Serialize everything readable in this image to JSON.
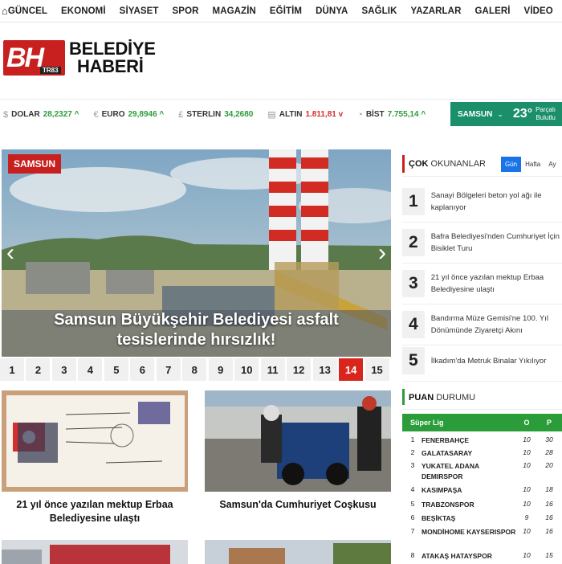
{
  "nav": {
    "home_icon": "home-icon",
    "items": [
      "GÜNCEL",
      "EKONOMİ",
      "SİYASET",
      "SPOR",
      "MAGAZİN",
      "EĞİTİM",
      "DÜNYA",
      "SAĞLIK",
      "YAZARLAR",
      "GALERİ",
      "VİDEO"
    ],
    "menu_icon": "≡ ▾"
  },
  "logo": {
    "mark": "BH",
    "badge": "TR83",
    "line1": "BELEDİYE",
    "line2": "HABERİ"
  },
  "ticker": [
    {
      "name": "DOLAR",
      "value": "28,2327",
      "trend": "up",
      "icon": "$"
    },
    {
      "name": "EURO",
      "value": "29,8946",
      "trend": "up",
      "icon": "€"
    },
    {
      "name": "STERLIN",
      "value": "34,2680",
      "trend": "none",
      "icon": "£"
    },
    {
      "name": "ALTIN",
      "value": "1.811,81",
      "trend": "down",
      "icon": "▤"
    },
    {
      "name": "BİST",
      "value": "7.755,14",
      "trend": "up",
      "icon": "◔"
    }
  ],
  "weather": {
    "city": "SAMSUN",
    "temp": "23°",
    "cond1": "Parçalı",
    "cond2": "Bulutlu"
  },
  "slider": {
    "category": "SAMSUN",
    "headline_line1": "Samsun Büyükşehir Belediyesi asfalt",
    "headline_line2": "tesislerinde hırsızlık!",
    "prev": "‹",
    "next": "›"
  },
  "pager": {
    "pages": [
      "1",
      "2",
      "3",
      "4",
      "5",
      "6",
      "7",
      "8",
      "9",
      "10",
      "11",
      "12",
      "13",
      "14",
      "15"
    ],
    "active": "14"
  },
  "cards": [
    {
      "title_line1": "21 yıl önce yazılan mektup Erbaa",
      "title_line2": "Belediyesine ulaştı"
    },
    {
      "title_line1": "Samsun'da Cumhuriyet Coşkusu",
      "title_line2": ""
    }
  ],
  "popular": {
    "title_bold": "ÇOK",
    "title_rest": " OKUNANLAR",
    "tabs": [
      "Gün",
      "Hafta",
      "Ay"
    ],
    "items": [
      {
        "num": "1",
        "text": "Sanayi Bölgeleri beton yol ağı ile kaplanıyor"
      },
      {
        "num": "2",
        "text": "Bafra Belediyesi'nden Cumhuriyet İçin Bisiklet Turu"
      },
      {
        "num": "3",
        "text": "21 yıl önce yazılan mektup Erbaa Belediyesine ulaştı"
      },
      {
        "num": "4",
        "text": "Bandırma Müze Gemisi'ne 100. Yıl Dönümünde Ziyaretçi Akını"
      },
      {
        "num": "5",
        "text": "İlkadım'da Metruk Binalar Yıkılıyor"
      }
    ]
  },
  "standings": {
    "title_bold": "PUAN",
    "title_rest": " DURUMU",
    "league": "Süper Lig",
    "col_o": "O",
    "col_p": "P",
    "rows": [
      {
        "r": "1",
        "team": "FENERBAHÇE",
        "o": "10",
        "p": "30"
      },
      {
        "r": "2",
        "team": "GALATASARAY",
        "o": "10",
        "p": "28"
      },
      {
        "r": "3",
        "team": "YUKATEL ADANA DEMIRSPOR",
        "o": "10",
        "p": "20"
      },
      {
        "r": "4",
        "team": "KASIMPAŞA",
        "o": "10",
        "p": "18"
      },
      {
        "r": "5",
        "team": "TRABZONSPOR",
        "o": "10",
        "p": "16"
      },
      {
        "r": "6",
        "team": "BEŞİKTAŞ",
        "o": "9",
        "p": "16"
      },
      {
        "r": "7",
        "team": "MONDİHOME KAYSERISPOR",
        "o": "10",
        "p": "16"
      },
      {
        "r": "8",
        "team": "ATAKAŞ HATAYSPOR",
        "o": "10",
        "p": "15"
      }
    ]
  }
}
